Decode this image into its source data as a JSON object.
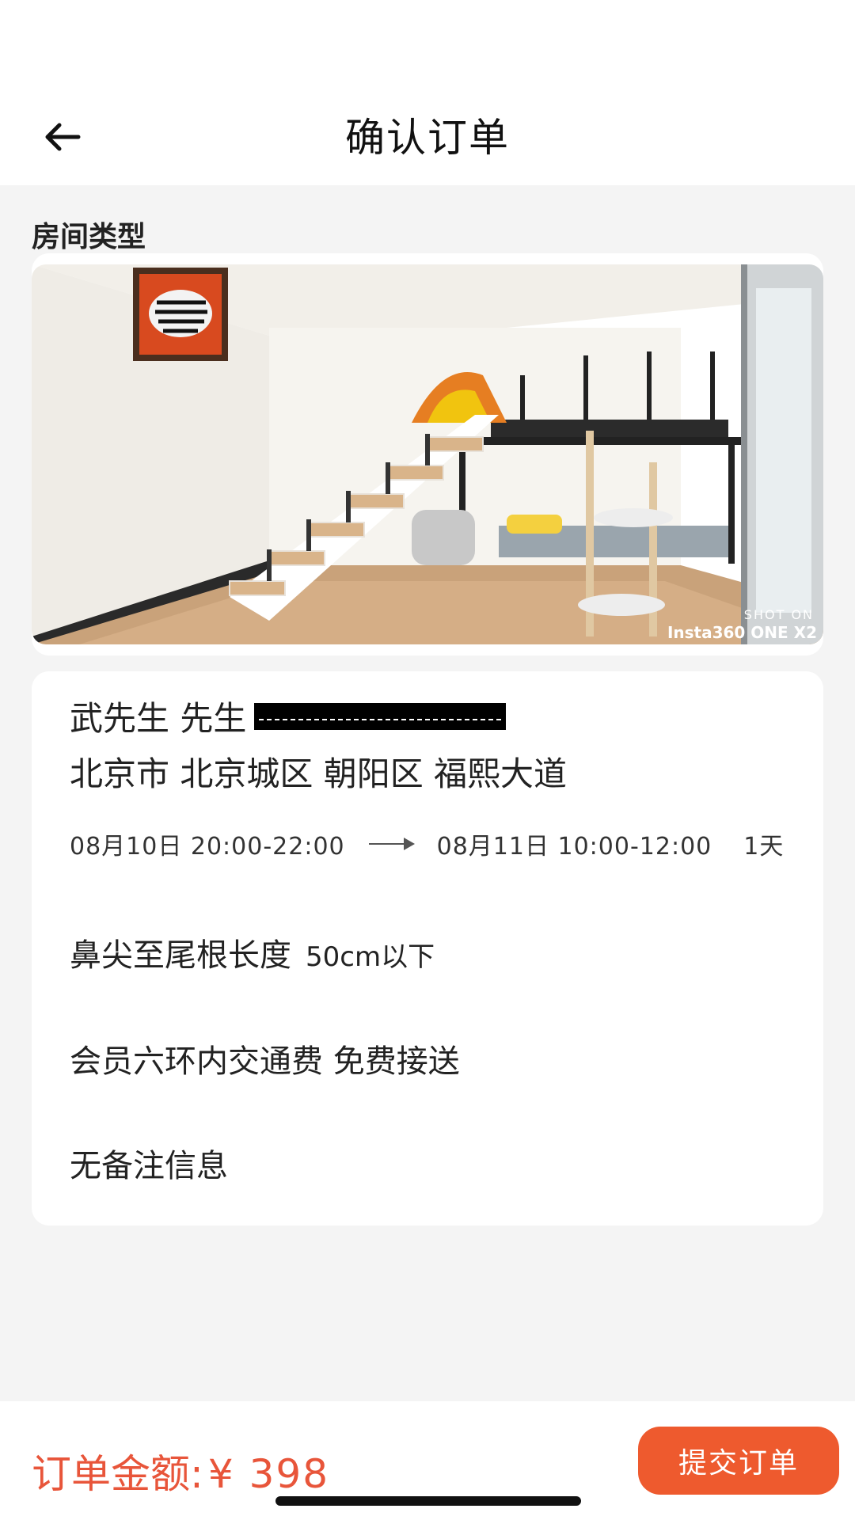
{
  "header": {
    "title": "确认订单",
    "back_icon": "arrow-left-icon"
  },
  "room": {
    "section_label": "房间类型",
    "photo_watermark_top": "SHOT ON",
    "photo_watermark_bottom": "Insta360 ONE X2"
  },
  "order": {
    "customer_name": "武先生 先生",
    "address": "北京市 北京城区 朝阳区 福熙大道",
    "start_time": "08月10日 20:00-22:00",
    "end_time": "08月11日 10:00-12:00",
    "duration": "1天",
    "size_label": "鼻尖至尾根长度",
    "size_value": "50cm以下",
    "transport": "会员六环内交通费 免费接送",
    "note": "无备注信息"
  },
  "footer": {
    "total_label": "订单金额:",
    "total_amount": "¥ 398",
    "submit_label": "提交订单"
  },
  "colors": {
    "accent": "#ee5a2e",
    "price": "#e8553a",
    "background": "#f4f4f4"
  }
}
